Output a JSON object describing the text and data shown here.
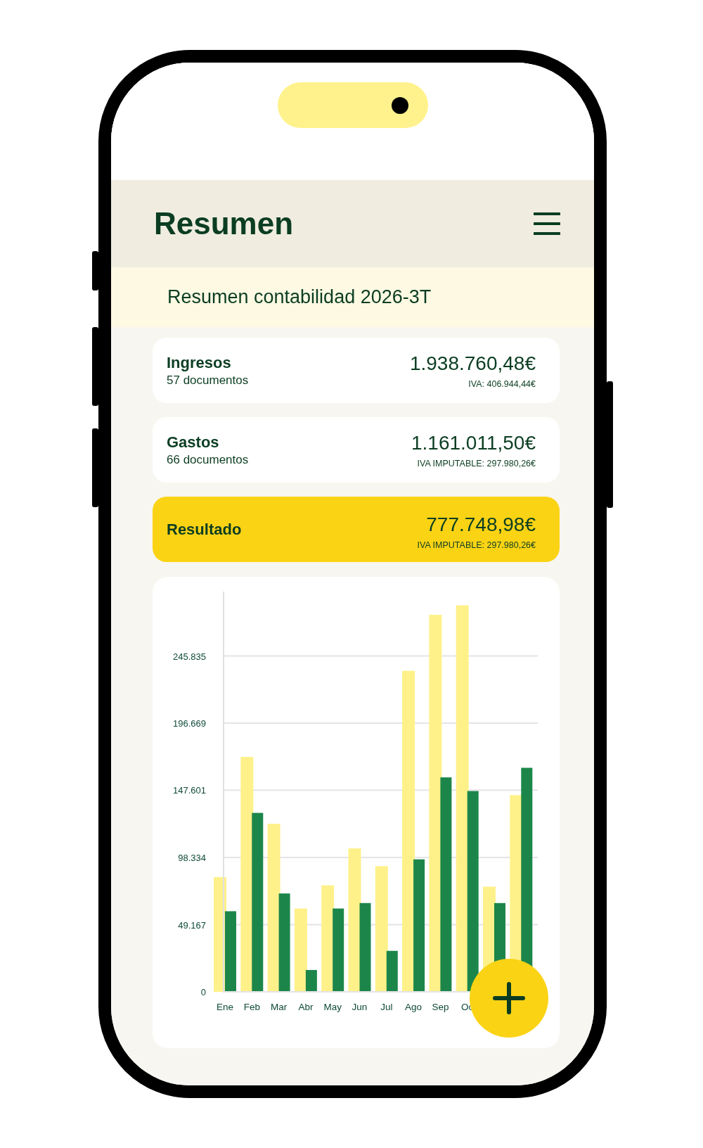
{
  "header": {
    "title": "Resumen"
  },
  "subheader": {
    "title": "Resumen contabilidad 2026-3T"
  },
  "cards": [
    {
      "kind": "plain",
      "title": "Ingresos",
      "subtitle": "57 documentos",
      "amount": "1.938.760,48€",
      "tax": "IVA: 406.944,44€"
    },
    {
      "kind": "plain",
      "title": "Gastos",
      "subtitle": "66 documentos",
      "amount": "1.161.011,50€",
      "tax": "IVA IMPUTABLE: 297.980,26€"
    },
    {
      "kind": "highlight",
      "title": "Resultado",
      "amount": "777.748,98€",
      "tax": "IVA IMPUTABLE: 297.980,26€"
    }
  ],
  "chart": {
    "chart_data": {
      "type": "bar",
      "categories": [
        "Ene",
        "Feb",
        "Mar",
        "Abr",
        "May",
        "Jun",
        "Jul",
        "Ago",
        "Sep",
        "Oc",
        null,
        null
      ],
      "series": [
        {
          "color": "#fef18a",
          "values": [
            84000,
            172000,
            123000,
            61000,
            78000,
            105000,
            92000,
            235000,
            276000,
            283000,
            77000,
            144000
          ]
        },
        {
          "color": "#1c864a",
          "values": [
            59000,
            131000,
            72000,
            16000,
            61000,
            65000,
            30000,
            97000,
            157000,
            147000,
            65000,
            164000
          ]
        }
      ],
      "ylim": [
        0,
        293000
      ],
      "grid": true,
      "yticks": [
        {
          "value": 0,
          "label": "0"
        },
        {
          "value": 49167,
          "label": "49.167"
        },
        {
          "value": 98334,
          "label": "98.334"
        },
        {
          "value": 147601,
          "label": "147.601"
        },
        {
          "value": 196669,
          "label": "196.669"
        },
        {
          "value": 245835,
          "label": "245.835"
        }
      ]
    }
  }
}
